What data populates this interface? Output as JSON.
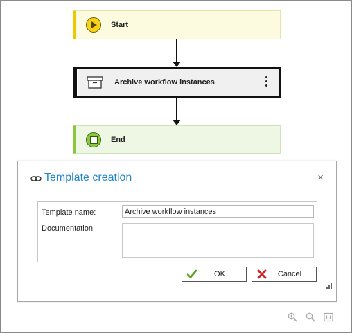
{
  "workflow": {
    "start_label": "Start",
    "task_label": "Archive workflow instances",
    "end_label": "End"
  },
  "dialog": {
    "title": "Template creation",
    "close_glyph": "×",
    "template_name_label": "Template name:",
    "template_name_value": "Archive workflow instances",
    "documentation_label": "Documentation:",
    "documentation_value": "",
    "ok_label": "OK",
    "cancel_label": "Cancel"
  },
  "icons": {
    "start": "play-icon",
    "task": "archive-box-icon",
    "end": "stop-icon",
    "title": "link-icon",
    "ok": "checkmark-icon",
    "cancel": "x-icon",
    "zoom_in": "zoom-in-icon",
    "zoom_out": "zoom-out-icon",
    "zoom_fit": "zoom-fit-icon"
  },
  "colors": {
    "start_accent": "#f0c800",
    "end_accent": "#8cc63f",
    "title_blue": "#1f86c8",
    "ok_green": "#5aa01e",
    "cancel_red": "#d0202a"
  }
}
